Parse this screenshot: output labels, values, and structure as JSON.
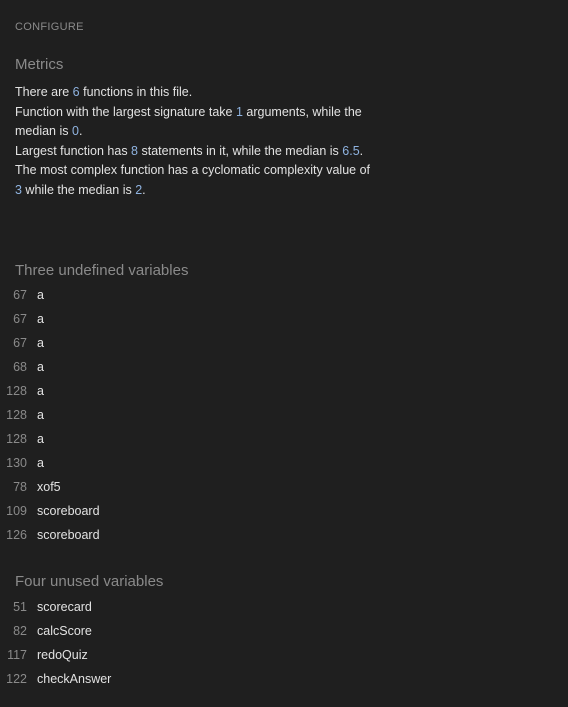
{
  "configure_label": "CONFIGURE",
  "metrics": {
    "title": "Metrics",
    "functions_count": "6",
    "largest_signature_args": "1",
    "signature_median": "0",
    "largest_statements": "8",
    "statements_median": "6.5",
    "max_complexity": "3",
    "complexity_median": "2",
    "text": {
      "s1_a": "There are ",
      "s1_b": " functions in this file.",
      "s2_a": "Function with the largest signature take ",
      "s2_b": " arguments, while the median is ",
      "s2_c": ".",
      "s3_a": "Largest function has ",
      "s3_b": " statements in it, while the median is ",
      "s3_c": ".",
      "s4_a": "The most complex function has a cyclomatic complexity value of ",
      "s4_b": " while the median is ",
      "s4_c": "."
    }
  },
  "undefined_variables": {
    "title": "Three undefined variables",
    "items": [
      {
        "line": "67",
        "name": "a"
      },
      {
        "line": "67",
        "name": "a"
      },
      {
        "line": "67",
        "name": "a"
      },
      {
        "line": "68",
        "name": "a"
      },
      {
        "line": "128",
        "name": "a"
      },
      {
        "line": "128",
        "name": "a"
      },
      {
        "line": "128",
        "name": "a"
      },
      {
        "line": "130",
        "name": "a"
      },
      {
        "line": "78",
        "name": "xof5"
      },
      {
        "line": "109",
        "name": "scoreboard"
      },
      {
        "line": "126",
        "name": "scoreboard"
      }
    ]
  },
  "unused_variables": {
    "title": "Four unused variables",
    "items": [
      {
        "line": "51",
        "name": "scorecard"
      },
      {
        "line": "82",
        "name": "calcScore"
      },
      {
        "line": "117",
        "name": "redoQuiz"
      },
      {
        "line": "122",
        "name": "checkAnswer"
      }
    ]
  }
}
